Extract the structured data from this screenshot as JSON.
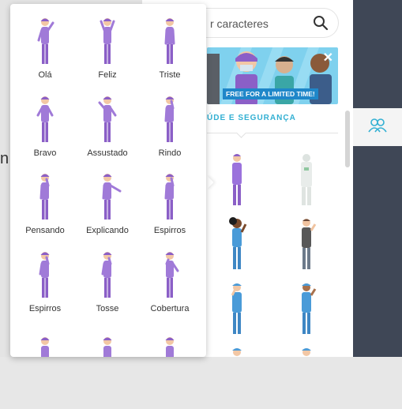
{
  "search": {
    "placeholder": "r caracteres",
    "icon": "search-icon"
  },
  "banner": {
    "label": "FREE FOR A LIMITED TIME!",
    "close": "✕"
  },
  "category": {
    "label": "ÚDE E SEGURANÇA"
  },
  "backdrop": {
    "partial_text": "n"
  },
  "rail": {
    "tab_icon": "people-icon"
  },
  "colors": {
    "accent": "#32b0d3",
    "rail": "#3f4756",
    "figure": "#a07ad8",
    "scrubs": "#4a9bd8"
  },
  "poses": [
    {
      "label": "Olá"
    },
    {
      "label": "Feliz"
    },
    {
      "label": "Triste"
    },
    {
      "label": "Bravo"
    },
    {
      "label": "Assustado"
    },
    {
      "label": "Rindo"
    },
    {
      "label": "Pensando"
    },
    {
      "label": "Explicando"
    },
    {
      "label": "Espirros"
    },
    {
      "label": "Espirros"
    },
    {
      "label": "Tosse"
    },
    {
      "label": "Cobertura"
    }
  ]
}
